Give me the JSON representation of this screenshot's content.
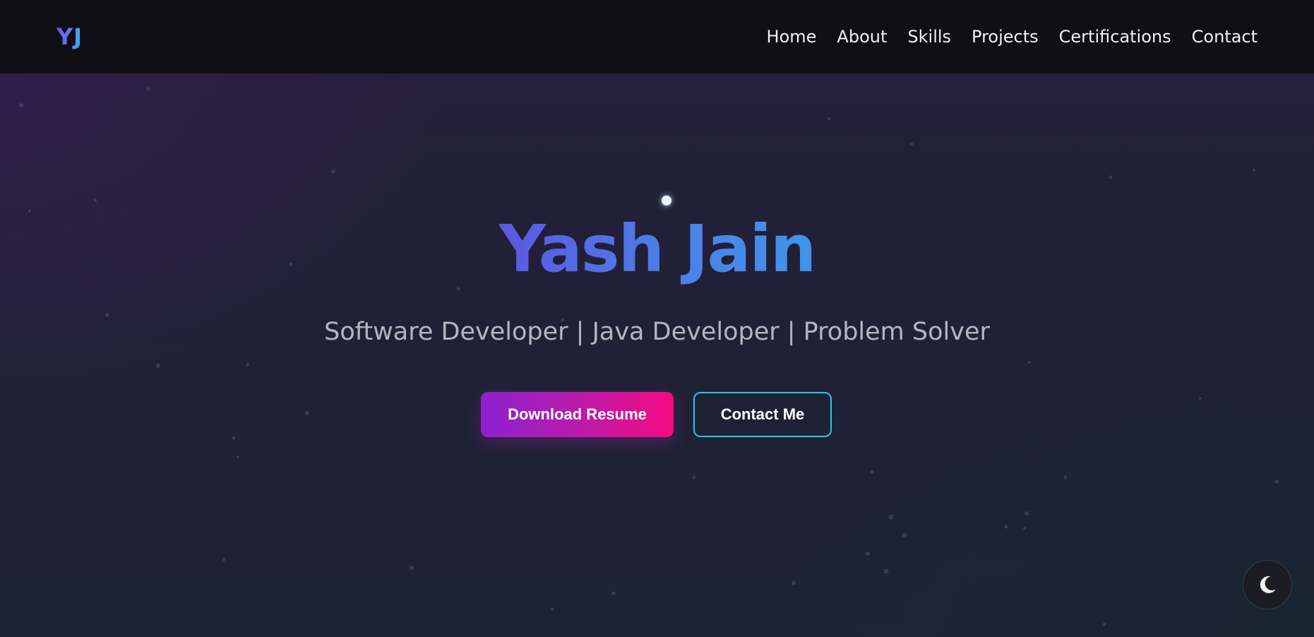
{
  "nav": {
    "logo": "YJ",
    "links": [
      "Home",
      "About",
      "Skills",
      "Projects",
      "Certifications",
      "Contact"
    ]
  },
  "hero": {
    "name": "Yash Jain",
    "subtitle": "Software Developer | Java Developer | Problem Solver",
    "primary_button": "Download Resume",
    "secondary_button": "Contact Me"
  },
  "icons": {
    "theme_toggle": "moon-icon"
  },
  "colors": {
    "nav_background": "#0f0f15",
    "hero_background": "#1f2136",
    "title_gradient_start": "#5b59e0",
    "title_gradient_end": "#3f95ea",
    "primary_gradient_start": "#8a22cf",
    "primary_gradient_end": "#f40a80",
    "outline_border": "#2ec6df",
    "subtitle_text": "#b6b4c0"
  }
}
